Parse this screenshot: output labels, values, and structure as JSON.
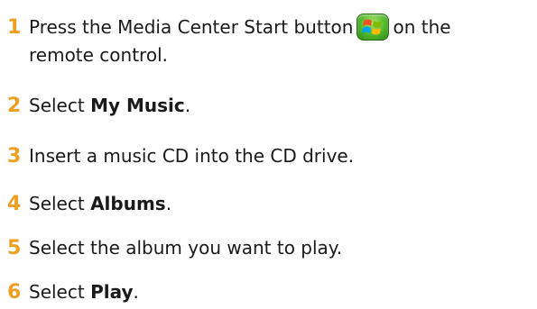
{
  "colors": {
    "step_number": "#f0a020",
    "text": "#1a1a1a",
    "start_button": "#4cb52a"
  },
  "steps": [
    {
      "number": "1",
      "text_before": "Press the Media Center Start button",
      "icon": "media-center-start-button-icon",
      "text_after": "on the",
      "continuation": "remote control."
    },
    {
      "number": "2",
      "text_before": "Select ",
      "bold": "My Music",
      "text_after": "."
    },
    {
      "number": "3",
      "text": "Insert a music CD into the CD drive."
    },
    {
      "number": "4",
      "text_before": "Select ",
      "bold": "Albums",
      "text_after": "."
    },
    {
      "number": "5",
      "text": "Select the album you want to play."
    },
    {
      "number": "6",
      "text_before": "Select ",
      "bold": "Play",
      "text_after": "."
    }
  ]
}
